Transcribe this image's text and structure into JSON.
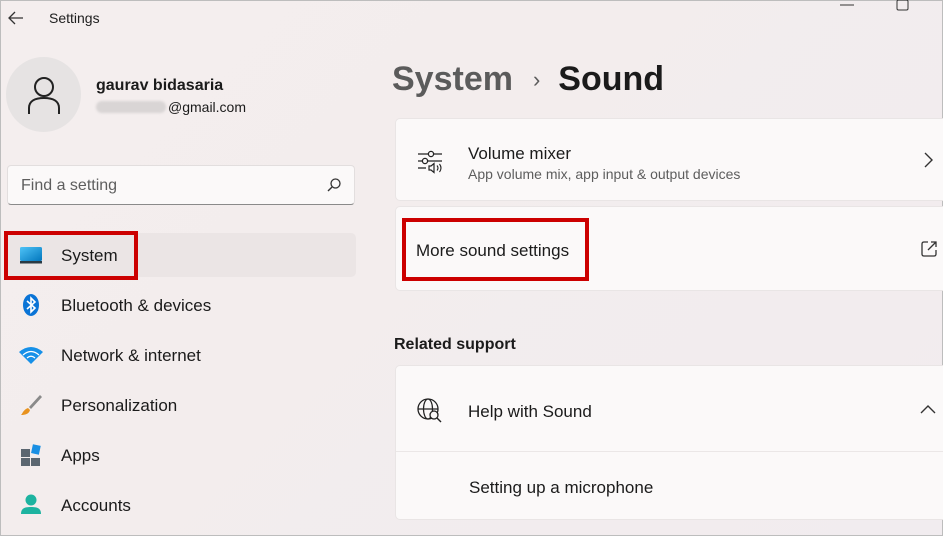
{
  "window": {
    "title": "Settings"
  },
  "user": {
    "name": "gaurav bidasaria",
    "email_suffix": "@gmail.com"
  },
  "search": {
    "placeholder": "Find a setting"
  },
  "sidebar": {
    "items": [
      {
        "label": "System",
        "icon": "system-monitor-icon",
        "active": true
      },
      {
        "label": "Bluetooth & devices",
        "icon": "bluetooth-icon",
        "active": false
      },
      {
        "label": "Network & internet",
        "icon": "wifi-icon",
        "active": false
      },
      {
        "label": "Personalization",
        "icon": "paintbrush-icon",
        "active": false
      },
      {
        "label": "Apps",
        "icon": "apps-icon",
        "active": false
      },
      {
        "label": "Accounts",
        "icon": "account-icon",
        "active": false
      }
    ]
  },
  "breadcrumb": {
    "parent": "System",
    "separator": "›",
    "current": "Sound"
  },
  "cards": {
    "volume_mixer": {
      "title": "Volume mixer",
      "subtitle": "App volume mix, app input & output devices"
    },
    "more_sound": {
      "label": "More sound settings"
    }
  },
  "related_support": {
    "heading": "Related support",
    "help_title": "Help with Sound",
    "links": [
      "Setting up a microphone"
    ]
  },
  "colors": {
    "highlight": "#cc0000",
    "accent": "#0067c0"
  }
}
